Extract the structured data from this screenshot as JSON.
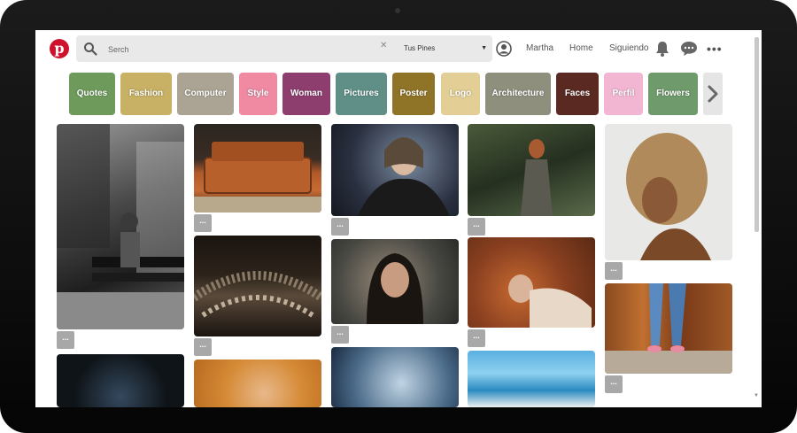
{
  "header": {
    "logo_letter": "p",
    "search_placeholder": "Serch",
    "pins_filter": "Tus Pines",
    "user_name": "Martha",
    "nav_home": "Home",
    "nav_following": "Siguiendo",
    "more_glyph": "•••"
  },
  "categories": [
    {
      "label": "Quotes",
      "color": "#6e9a5c"
    },
    {
      "label": "Fashion",
      "color": "#c8b164"
    },
    {
      "label": "Computer",
      "color": "#aba494"
    },
    {
      "label": "Style",
      "color": "#f08aa3"
    },
    {
      "label": "Woman",
      "color": "#8d3e6e"
    },
    {
      "label": "Pictures",
      "color": "#5f8f86"
    },
    {
      "label": "Poster",
      "color": "#8f7327"
    },
    {
      "label": "Logo",
      "color": "#e3cf95"
    },
    {
      "label": "Architecture",
      "color": "#8f8f7e"
    },
    {
      "label": "Faces",
      "color": "#5a2a22"
    },
    {
      "label": "Perfil",
      "color": "#f2b6d3"
    },
    {
      "label": "Flowers",
      "color": "#6e9a6c"
    }
  ],
  "pin_more_label": "...",
  "colors": {
    "brand": "#d0112b",
    "search_bg": "#e9e9e9"
  }
}
